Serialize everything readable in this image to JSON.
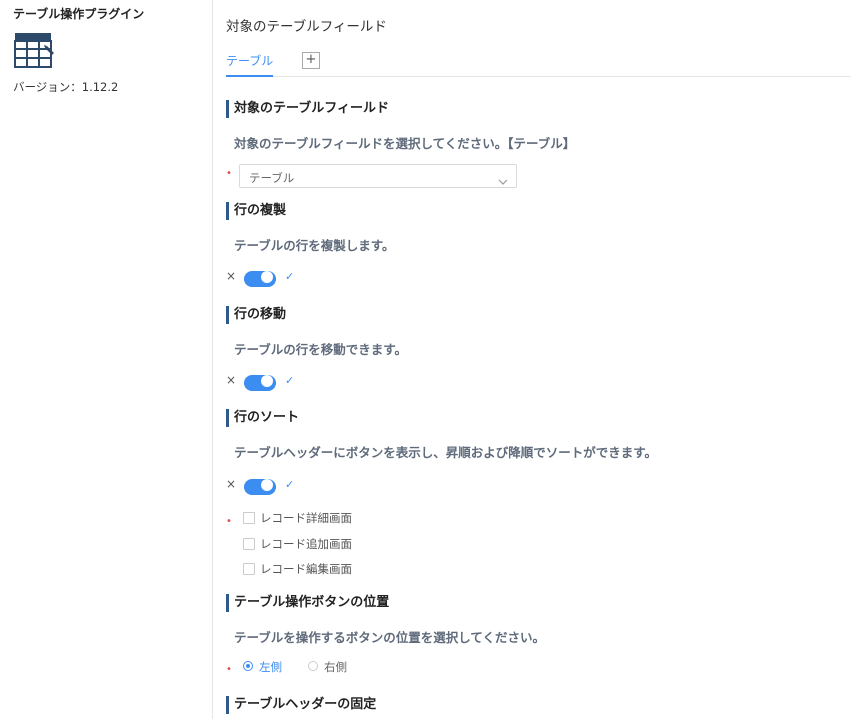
{
  "sidebar": {
    "plugin_title": "テーブル操作プラグイン",
    "icon": "table-edit-icon",
    "version": "バージョン：1.12.2"
  },
  "main": {
    "page_title": "対象のテーブルフィールド",
    "tabs": [
      {
        "label": "テーブル",
        "active": true
      }
    ],
    "add_tab_label": "+",
    "sections": {
      "target": {
        "title": "対象のテーブルフィールド",
        "desc": "対象のテーブルフィールドを選択してください。【テーブル】",
        "select_value": "テーブル"
      },
      "copy": {
        "title": "行の複製",
        "desc": "テーブルの行を複製します。",
        "enabled": true
      },
      "move": {
        "title": "行の移動",
        "desc": "テーブルの行を移動できます。",
        "enabled": true
      },
      "sort": {
        "title": "行のソート",
        "desc": "テーブルヘッダーにボタンを表示し、昇順および降順でソートができます。",
        "enabled": true,
        "options": [
          {
            "label": "レコード詳細画面",
            "checked": false
          },
          {
            "label": "レコード追加画面",
            "checked": false
          },
          {
            "label": "レコード編集画面",
            "checked": false
          }
        ]
      },
      "button_position": {
        "title": "テーブル操作ボタンの位置",
        "desc": "テーブルを操作するボタンの位置を選択してください。",
        "options": [
          {
            "label": "左側",
            "selected": true
          },
          {
            "label": "右側",
            "selected": false
          }
        ]
      },
      "header_fix": {
        "title": "テーブルヘッダーの固定"
      }
    },
    "toggle_off_symbol": "×",
    "toggle_on_symbol": "✓",
    "required_mark": "•"
  },
  "colors": {
    "accent": "#3c8df2",
    "section_bar": "#2e5a8c",
    "required": "#e5484d"
  }
}
